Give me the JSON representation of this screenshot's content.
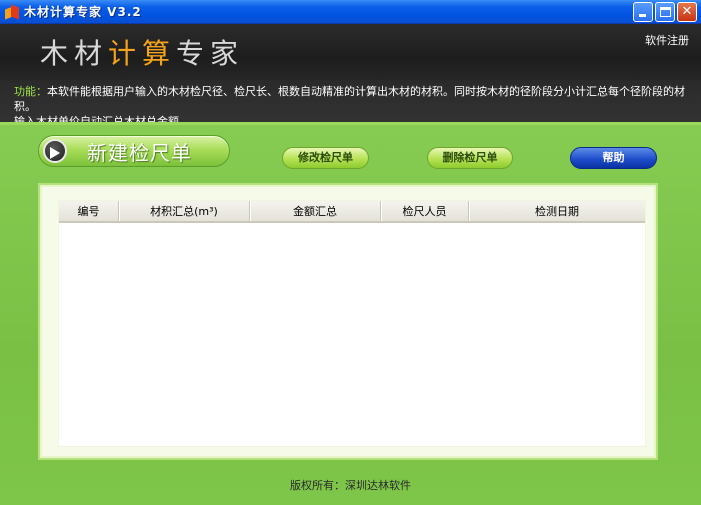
{
  "window": {
    "title": "木材计算专家 V3.2"
  },
  "header": {
    "logo_white_1": "木材",
    "logo_orange": "计算",
    "logo_white_2": "专家",
    "register_link": "软件注册"
  },
  "info": {
    "label": "功能：",
    "text_line1": "本软件能根据用户输入的木材检尺径、检尺长、根数自动精准的计算出木材的材积。同时按木材的径阶段分小计汇总每个径阶段的材积。",
    "text_line2": "输入木材单价自动汇总木材总金额。"
  },
  "toolbar": {
    "new_label": "新建检尺单",
    "edit_label": "修改检尺单",
    "delete_label": "删除检尺单",
    "help_label": "帮助"
  },
  "table": {
    "columns": [
      "编号",
      "材积汇总(m³)",
      "金额汇总",
      "检尺人员",
      "检测日期"
    ]
  },
  "footer": {
    "copyright": "版权所有：深圳达林软件"
  }
}
